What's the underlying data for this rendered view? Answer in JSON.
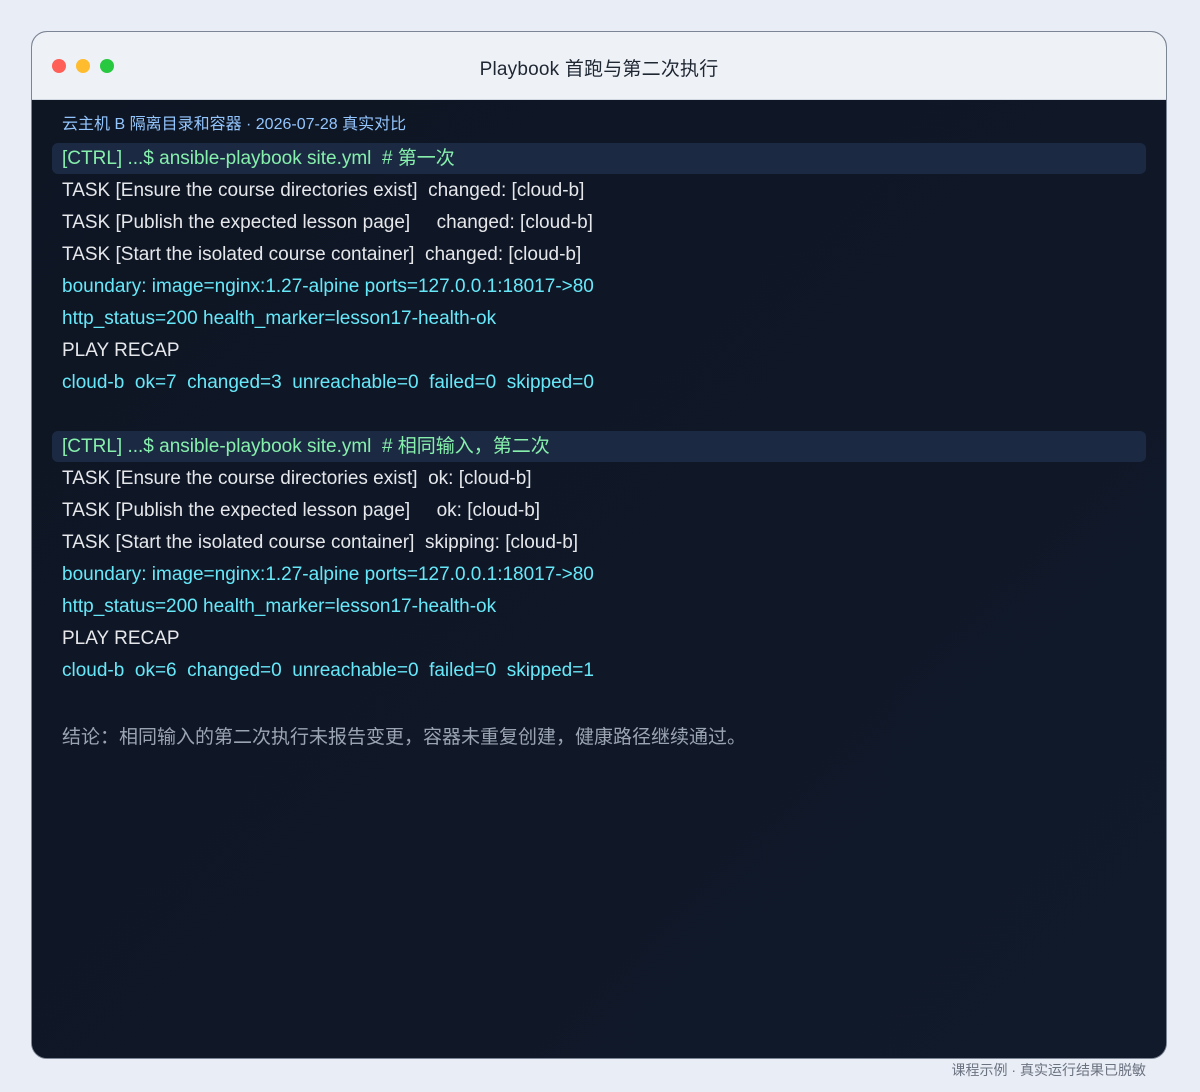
{
  "window": {
    "title": "Playbook 首跑与第二次执行"
  },
  "terminal": {
    "meta": "云主机 B 隔离目录和容器 · 2026-07-28 真实对比",
    "runs": [
      {
        "command": "[CTRL] ...$ ansible-playbook site.yml  # 第一次",
        "lines": [
          "TASK [Ensure the course directories exist]  changed: [cloud-b]",
          "TASK [Publish the expected lesson page]     changed: [cloud-b]",
          "TASK [Start the isolated course container]  changed: [cloud-b]",
          "boundary: image=nginx:1.27-alpine ports=127.0.0.1:18017->80",
          "http_status=200 health_marker=lesson17-health-ok",
          "PLAY RECAP",
          "cloud-b  ok=7  changed=3  unreachable=0  failed=0  skipped=0"
        ]
      },
      {
        "command": "[CTRL] ...$ ansible-playbook site.yml  # 相同输入，第二次",
        "lines": [
          "TASK [Ensure the course directories exist]  ok: [cloud-b]",
          "TASK [Publish the expected lesson page]     ok: [cloud-b]",
          "TASK [Start the isolated course container]  skipping: [cloud-b]",
          "boundary: image=nginx:1.27-alpine ports=127.0.0.1:18017->80",
          "http_status=200 health_marker=lesson17-health-ok",
          "PLAY RECAP",
          "cloud-b  ok=6  changed=0  unreachable=0  failed=0  skipped=1"
        ]
      }
    ],
    "conclusion": "结论：相同输入的第二次执行未报告变更，容器未重复创建，健康路径继续通过。"
  },
  "footer": {
    "note": "课程示例 · 真实运行结果已脱敏"
  },
  "colors": {
    "command": "#86efac",
    "task": "#e5e7eb",
    "info": "#67e8f9",
    "meta": "#93c5fd",
    "conclusion": "#9aa4b2",
    "terminal_bg": "#0f1624",
    "command_bg": "#1b2a42"
  }
}
